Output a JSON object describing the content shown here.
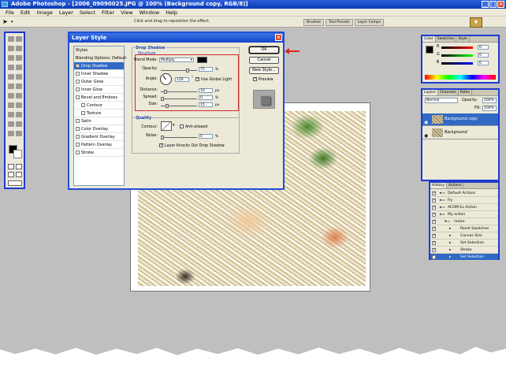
{
  "window": {
    "title": "Adobe Photoshop - [2006_09090025.JPG @ 100% (Background copy, RGB/8)]"
  },
  "menu": [
    "File",
    "Edit",
    "Image",
    "Layer",
    "Select",
    "Filter",
    "View",
    "Window",
    "Help"
  ],
  "options_bar": {
    "hint": "Click and drag to reposition the effect.",
    "wells": [
      "Brushes",
      "Tool Presets",
      "Layer Comps"
    ]
  },
  "dialog": {
    "title": "Layer Style",
    "styles": [
      {
        "label": "Styles",
        "type": "head"
      },
      {
        "label": "Blending Options: Default",
        "type": "head"
      },
      {
        "label": "Drop Shadow",
        "checked": true,
        "selected": true
      },
      {
        "label": "Inner Shadow"
      },
      {
        "label": "Outer Glow"
      },
      {
        "label": "Inner Glow"
      },
      {
        "label": "Bevel and Emboss"
      },
      {
        "label": "Contour",
        "indent": true
      },
      {
        "label": "Texture",
        "indent": true
      },
      {
        "label": "Satin"
      },
      {
        "label": "Color Overlay"
      },
      {
        "label": "Gradient Overlay"
      },
      {
        "label": "Pattern Overlay"
      },
      {
        "label": "Stroke"
      }
    ],
    "drop_shadow": {
      "section_title": "Drop Shadow",
      "structure_title": "Structure",
      "blend_mode_label": "Blend Mode:",
      "blend_mode": "Multiply",
      "opacity_label": "Opacity:",
      "opacity": "75",
      "opacity_unit": "%",
      "angle_label": "Angle:",
      "angle": "120",
      "angle_unit": "°",
      "global_light": "Use Global Light",
      "distance_label": "Distance:",
      "distance": "10",
      "distance_unit": "px",
      "spread_label": "Spread:",
      "spread": "0",
      "spread_unit": "%",
      "size_label": "Size:",
      "size": "15",
      "size_unit": "px"
    },
    "quality": {
      "title": "Quality",
      "contour_label": "Contour:",
      "anti_aliased": "Anti-aliased",
      "noise_label": "Noise:",
      "noise": "0",
      "noise_unit": "%",
      "knockout": "Layer Knocks Out Drop Shadow"
    },
    "buttons": {
      "ok": "OK",
      "cancel": "Cancel",
      "new_style": "New Style...",
      "preview": "Preview"
    }
  },
  "color_panel": {
    "tabs": [
      "Color",
      "Swatches",
      "Style"
    ],
    "channels": [
      "R",
      "G",
      "B"
    ],
    "values": [
      "0",
      "0",
      "0"
    ]
  },
  "layers_panel": {
    "tabs": [
      "Layers",
      "Channels",
      "Paths"
    ],
    "blend": "Normal",
    "opacity_label": "Opacity:",
    "opacity": "100%",
    "fill_label": "Fill:",
    "fill": "100%",
    "layers": [
      {
        "name": "Background copy",
        "selected": true
      },
      {
        "name": "Background"
      }
    ]
  },
  "actions_panel": {
    "tabs": [
      "History",
      "Actions"
    ],
    "items": [
      {
        "label": "Default Actions",
        "level": 0
      },
      {
        "label": "fry",
        "level": 0
      },
      {
        "label": "ACOM Ex Action",
        "level": 0
      },
      {
        "label": "My action",
        "level": 0
      },
      {
        "label": "resize",
        "level": 1
      },
      {
        "label": "Reset Swatches",
        "level": 2
      },
      {
        "label": "Canvas Size",
        "level": 2
      },
      {
        "label": "Set Selection",
        "level": 2
      },
      {
        "label": "Stroke",
        "level": 2
      },
      {
        "label": "Set Selection",
        "level": 2,
        "selected": true
      }
    ]
  }
}
